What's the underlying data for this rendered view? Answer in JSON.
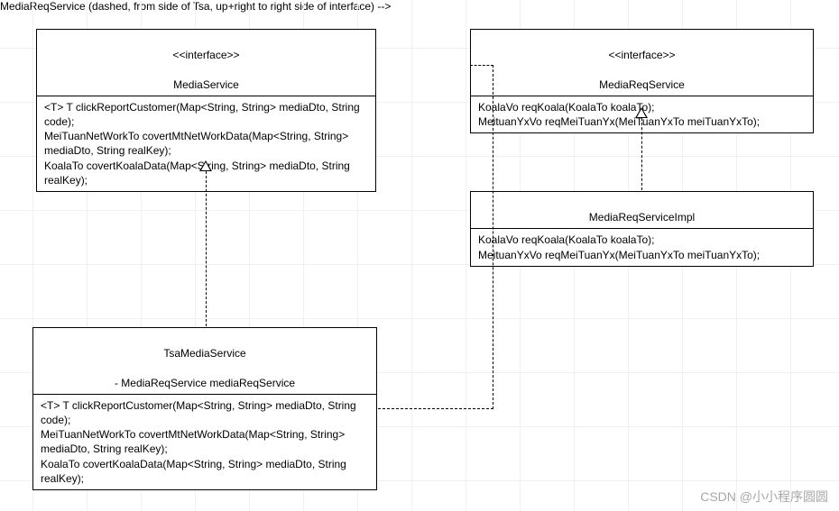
{
  "classes": {
    "mediaService": {
      "stereotype": "<<interface>>",
      "name": "MediaService",
      "methods": "<T> T clickReportCustomer(Map<String, String> mediaDto, String code);\nMeiTuanNetWorkTo covertMtNetWorkData(Map<String, String> mediaDto, String realKey);\nKoalaTo covertKoalaData(Map<String, String> mediaDto, String realKey);"
    },
    "mediaReqService": {
      "stereotype": "<<interface>>",
      "name": "MediaReqService",
      "methods": "KoalaVo reqKoala(KoalaTo koalaTo);\nMeituanYxVo reqMeiTuanYx(MeiTuanYxTo meiTuanYxTo);"
    },
    "tsaMediaService": {
      "name": "TsaMediaService",
      "attrs": "- MediaReqService mediaReqService",
      "methods": "<T> T clickReportCustomer(Map<String, String> mediaDto, String code);\nMeiTuanNetWorkTo covertMtNetWorkData(Map<String, String> mediaDto, String realKey);\nKoalaTo covertKoalaData(Map<String, String> mediaDto, String realKey);"
    },
    "mediaReqServiceImpl": {
      "name": "MediaReqServiceImpl",
      "methods": "KoalaVo reqKoala(KoalaTo koalaTo);\nMeituanYxVo reqMeiTuanYx(MeiTuanYxTo meiTuanYxTo);"
    }
  },
  "watermark": "CSDN @小小程序圆圆"
}
